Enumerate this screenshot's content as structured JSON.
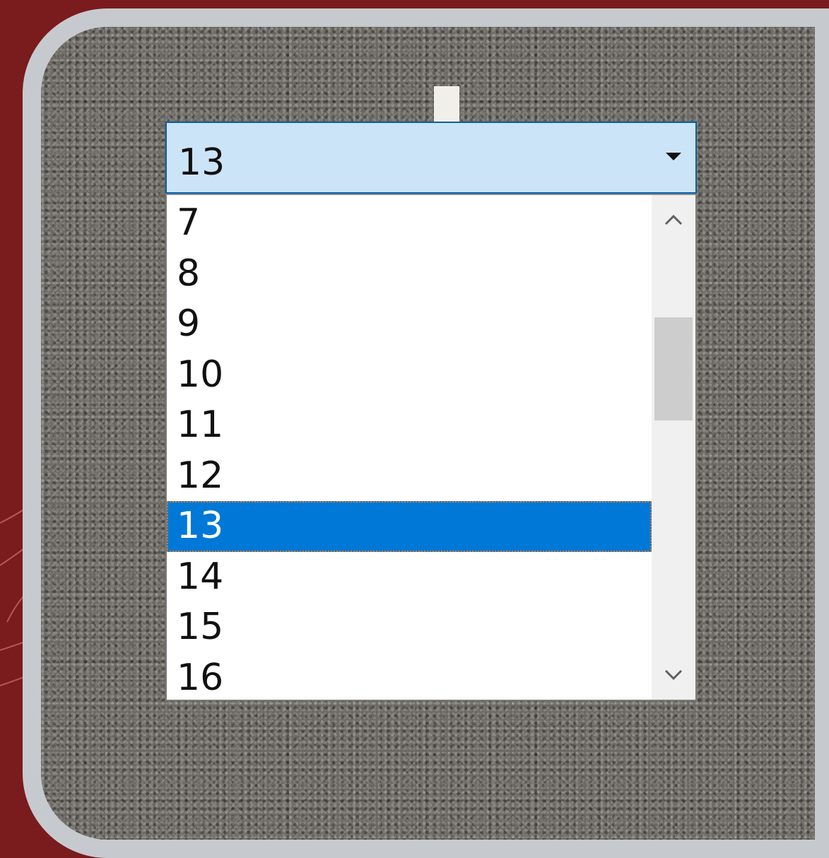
{
  "combo": {
    "selected_value": "13"
  },
  "list": {
    "items": [
      "7",
      "8",
      "9",
      "10",
      "11",
      "12",
      "13",
      "14",
      "15",
      "16"
    ],
    "selected_index": 6
  },
  "scrollbar": {
    "position_fraction": 0.24
  },
  "icons": {
    "dropdown": "caret-down-icon",
    "scroll_up": "chevron-up-icon",
    "scroll_down": "chevron-down-icon"
  },
  "colors": {
    "background": "#7a1b1d",
    "frame": "#c6cacf",
    "combo_fill": "#cce4f7",
    "combo_border": "#0a5fa6",
    "selection": "#0078d7",
    "focus_outline": "#e07a20"
  }
}
